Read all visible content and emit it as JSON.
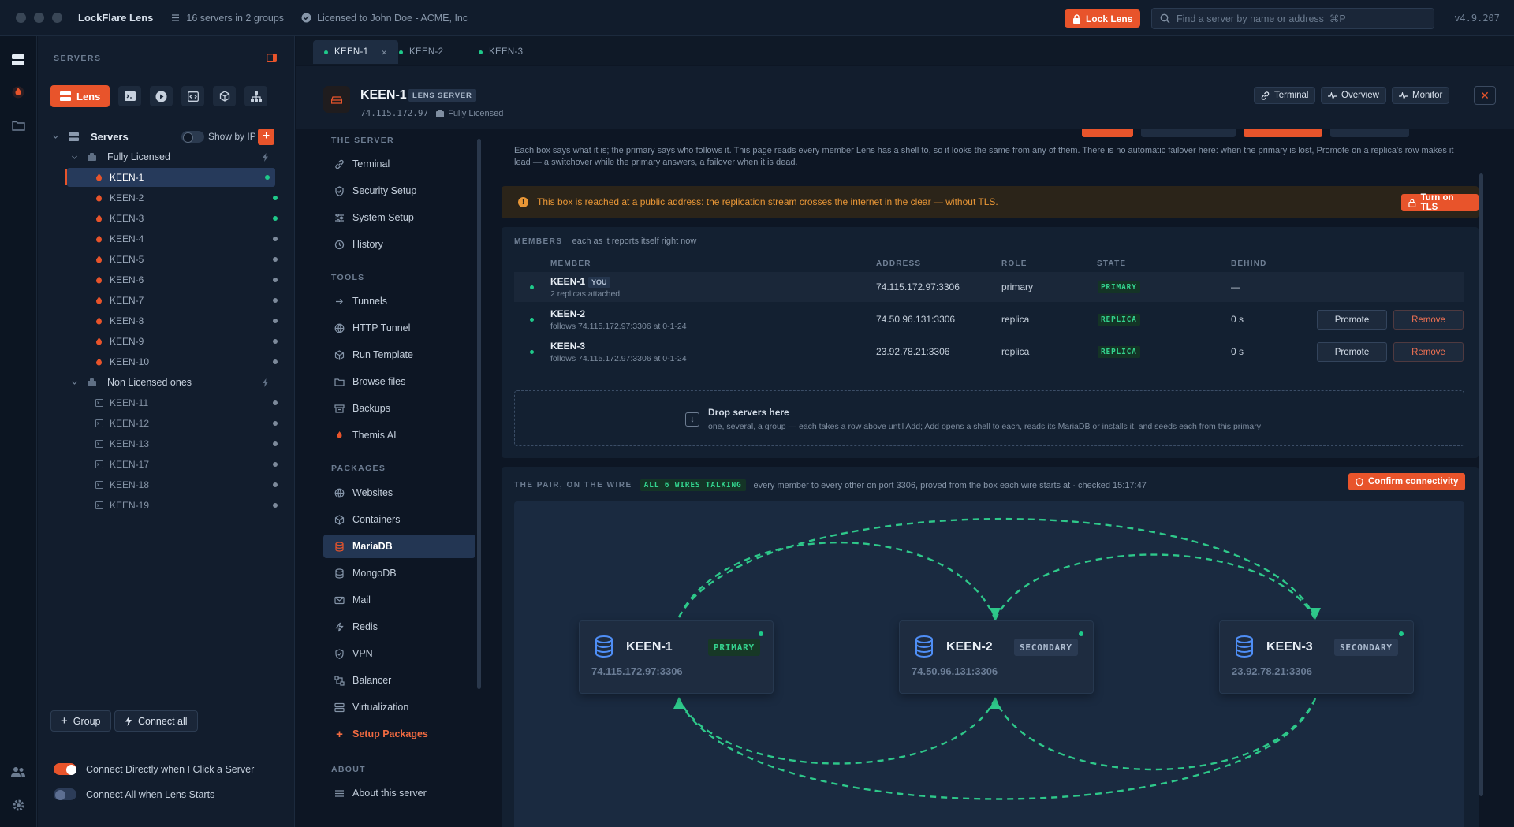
{
  "titlebar": {
    "app_name": "LockFlare Lens",
    "servers_info": "16 servers in 2 groups",
    "license_info": "Licensed to John Doe - ACME, Inc",
    "lock_label": "Lock Lens",
    "search_placeholder": "Find a server by name or address  ⌘P",
    "version": "v4.9.207"
  },
  "sidebar": {
    "title": "SERVERS",
    "lens_label": "Lens",
    "root_label": "Servers",
    "show_by_ip": "Show by IP",
    "groups": [
      {
        "label": "Fully Licensed",
        "servers": [
          {
            "name": "KEEN-1",
            "status": "online",
            "selected": true
          },
          {
            "name": "KEEN-2",
            "status": "online"
          },
          {
            "name": "KEEN-3",
            "status": "online"
          },
          {
            "name": "KEEN-4",
            "status": "idle"
          },
          {
            "name": "KEEN-5",
            "status": "idle"
          },
          {
            "name": "KEEN-6",
            "status": "idle"
          },
          {
            "name": "KEEN-7",
            "status": "idle"
          },
          {
            "name": "KEEN-8",
            "status": "idle"
          },
          {
            "name": "KEEN-9",
            "status": "idle"
          },
          {
            "name": "KEEN-10",
            "status": "idle"
          }
        ]
      },
      {
        "label": "Non Licensed ones",
        "servers": [
          {
            "name": "KEEN-11",
            "status": "idle"
          },
          {
            "name": "KEEN-12",
            "status": "idle"
          },
          {
            "name": "KEEN-13",
            "status": "idle"
          },
          {
            "name": "KEEN-17",
            "status": "idle"
          },
          {
            "name": "KEEN-18",
            "status": "idle"
          },
          {
            "name": "KEEN-19",
            "status": "idle"
          }
        ]
      }
    ],
    "group_button": "Group",
    "connect_all_button": "Connect all",
    "toggle_connect_directly": "Connect Directly when I Click a Server",
    "toggle_connect_all": "Connect All when Lens Starts"
  },
  "tabs": [
    {
      "label": "KEEN-1",
      "active": true
    },
    {
      "label": "KEEN-2",
      "active": false
    },
    {
      "label": "KEEN-3",
      "active": false
    }
  ],
  "server": {
    "name": "KEEN-1",
    "badge": "LENS SERVER",
    "address": "74.115.172.97",
    "license": "Fully Licensed",
    "buttons": {
      "terminal": "Terminal",
      "overview": "Overview",
      "monitor": "Monitor"
    }
  },
  "nav": {
    "section_server": "THE SERVER",
    "server_items": [
      "Terminal",
      "Security Setup",
      "System Setup",
      "History"
    ],
    "section_tools": "TOOLS",
    "tool_items": [
      "Tunnels",
      "HTTP Tunnel",
      "Run Template",
      "Browse files",
      "Backups",
      "Themis AI"
    ],
    "section_packages": "PACKAGES",
    "package_items": [
      "Websites",
      "Containers",
      "MariaDB",
      "MongoDB",
      "Mail",
      "Redis",
      "VPN",
      "Balancer",
      "Virtualization"
    ],
    "setup_packages": "Setup Packages",
    "section_about": "ABOUT",
    "about_item": "About this server"
  },
  "main": {
    "intro": "Each box says what it is; the primary says who follows it. This page reads every member Lens has a shell to, so it looks the same from any of them. There is no automatic failover here: when the primary is lost, Promote on a replica's row makes it lead — a switchover while the primary answers, a failover when it is dead.",
    "warning": "This box is reached at a public address: the replication stream crosses the internet in the clear — without TLS.",
    "tls_button": "Turn on TLS",
    "members_title": "MEMBERS",
    "members_sub": "each as it reports itself right now",
    "columns": [
      "MEMBER",
      "ADDRESS",
      "ROLE",
      "STATE",
      "BEHIND"
    ],
    "rows": [
      {
        "name": "KEEN-1",
        "you": "YOU",
        "sub": "2 replicas attached",
        "address": "74.115.172.97:3306",
        "role": "primary",
        "state": "PRIMARY",
        "behind": "—"
      },
      {
        "name": "KEEN-2",
        "sub": "follows 74.115.172.97:3306 at 0-1-24",
        "address": "74.50.96.131:3306",
        "role": "replica",
        "state": "REPLICA",
        "behind": "0 s"
      },
      {
        "name": "KEEN-3",
        "sub": "follows 74.115.172.97:3306 at 0-1-24",
        "address": "23.92.78.21:3306",
        "role": "replica",
        "state": "REPLICA",
        "behind": "0 s"
      }
    ],
    "promote": "Promote",
    "remove": "Remove",
    "drop_title": "Drop servers here",
    "drop_sub": "one, several, a group — each takes a row above until Add; Add opens a shell to each, reads its MariaDB or installs it, and seeds each from this primary",
    "wire_title": "THE PAIR, ON THE WIRE",
    "wire_badge": "ALL 6 WIRES TALKING",
    "wire_sub": "every member to every other on port 3306, proved from the box each wire starts at · checked 15:17:47",
    "confirm_button": "Confirm connectivity",
    "nodes": [
      {
        "name": "KEEN-1",
        "role": "PRIMARY",
        "address": "74.115.172.97:3306"
      },
      {
        "name": "KEEN-2",
        "role": "SECONDARY",
        "address": "74.50.96.131:3306"
      },
      {
        "name": "KEEN-3",
        "role": "SECONDARY",
        "address": "23.92.78.21:3306"
      }
    ]
  },
  "colors": {
    "accent": "#e8542b",
    "online": "#1fc98a",
    "link": "#2ec88a"
  }
}
